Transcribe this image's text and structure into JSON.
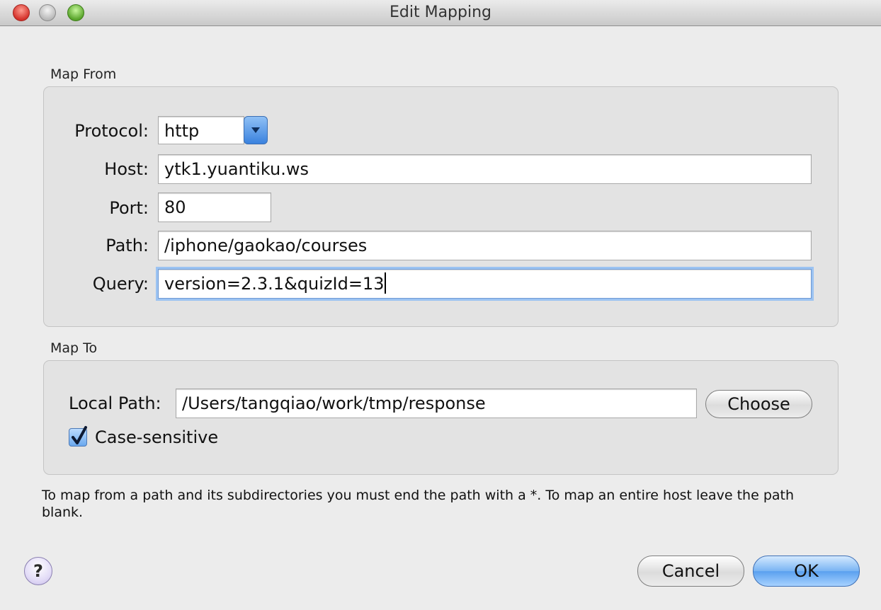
{
  "window": {
    "title": "Edit Mapping"
  },
  "map_from": {
    "group_label": "Map From",
    "protocol": {
      "label": "Protocol:",
      "value": "http"
    },
    "host": {
      "label": "Host:",
      "value": "ytk1.yuantiku.ws"
    },
    "port": {
      "label": "Port:",
      "value": "80"
    },
    "path": {
      "label": "Path:",
      "value": "/iphone/gaokao/courses"
    },
    "query": {
      "label": "Query:",
      "value": "version=2.3.1&quizId=13"
    }
  },
  "map_to": {
    "group_label": "Map To",
    "local_path": {
      "label": "Local Path:",
      "value": "/Users/tangqiao/work/tmp/response"
    },
    "choose_label": "Choose",
    "case_sensitive": {
      "label": "Case-sensitive",
      "checked": true
    }
  },
  "help_text": "To map from a path and its subdirectories you must end the path with a *. To map an entire host leave the path blank.",
  "buttons": {
    "help_label": "?",
    "cancel_label": "Cancel",
    "ok_label": "OK"
  },
  "icons": {
    "close": "close-window-icon",
    "minimize": "minimize-window-icon",
    "zoom": "zoom-window-icon",
    "dropdown": "chevron-down-icon",
    "checkmark": "checkmark-icon"
  },
  "colors": {
    "window_bg": "#ececec",
    "group_bg": "#e3e3e3",
    "focus_ring": "#9cc3f2",
    "accent_blue": "#5aa0ef"
  }
}
